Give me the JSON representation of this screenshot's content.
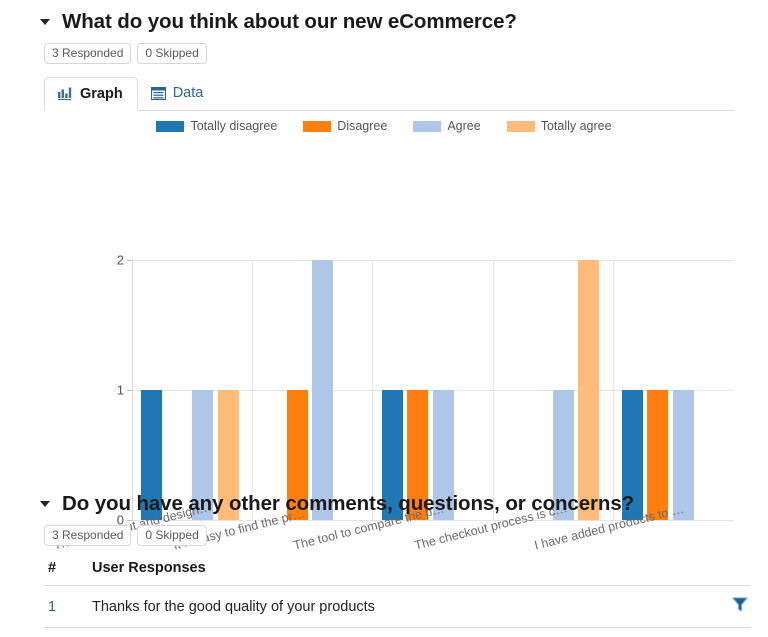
{
  "colors": {
    "totally_disagree": "#1f77b4",
    "disagree": "#ff7f0e",
    "agree": "#aec7e8",
    "totally_agree": "#ffbb78",
    "link": "#2a6496",
    "grid": "#e4e4e4"
  },
  "question1": {
    "title": "What do you think about our new eCommerce?",
    "responded_badge": "3 Responded",
    "skipped_badge": "0 Skipped",
    "tabs": [
      {
        "label": "Graph",
        "icon": "bar-chart-icon",
        "active": true
      },
      {
        "label": "Data",
        "icon": "table-icon",
        "active": false
      }
    ]
  },
  "chart_data": {
    "type": "bar",
    "title": "",
    "xlabel": "",
    "ylabel": "",
    "ylim": [
      0,
      2
    ],
    "yticks": [
      "0",
      "1",
      "2"
    ],
    "grid": true,
    "legend_position": "top",
    "categories": [
      "The new layout and design…",
      "It is easy to find the pr…",
      "The tool to compare the p…",
      "The checkout process is c…",
      "I have added products to …"
    ],
    "series": [
      {
        "name": "Totally disagree",
        "color": "#1f77b4",
        "values": [
          1,
          0,
          1,
          0,
          1
        ]
      },
      {
        "name": "Disagree",
        "color": "#ff7f0e",
        "values": [
          0,
          1,
          1,
          0,
          1
        ]
      },
      {
        "name": "Agree",
        "color": "#aec7e8",
        "values": [
          1,
          2,
          1,
          1,
          1
        ]
      },
      {
        "name": "Totally agree",
        "color": "#ffbb78",
        "values": [
          1,
          0,
          0,
          2,
          0
        ]
      }
    ]
  },
  "question2": {
    "title": "Do you have any other comments, questions, or concerns?",
    "responded_badge": "3 Responded",
    "skipped_badge": "0 Skipped",
    "table": {
      "headers": [
        "#",
        "User Responses"
      ],
      "rows": [
        {
          "num": "1",
          "response": "Thanks for the good quality of your products"
        }
      ]
    }
  }
}
